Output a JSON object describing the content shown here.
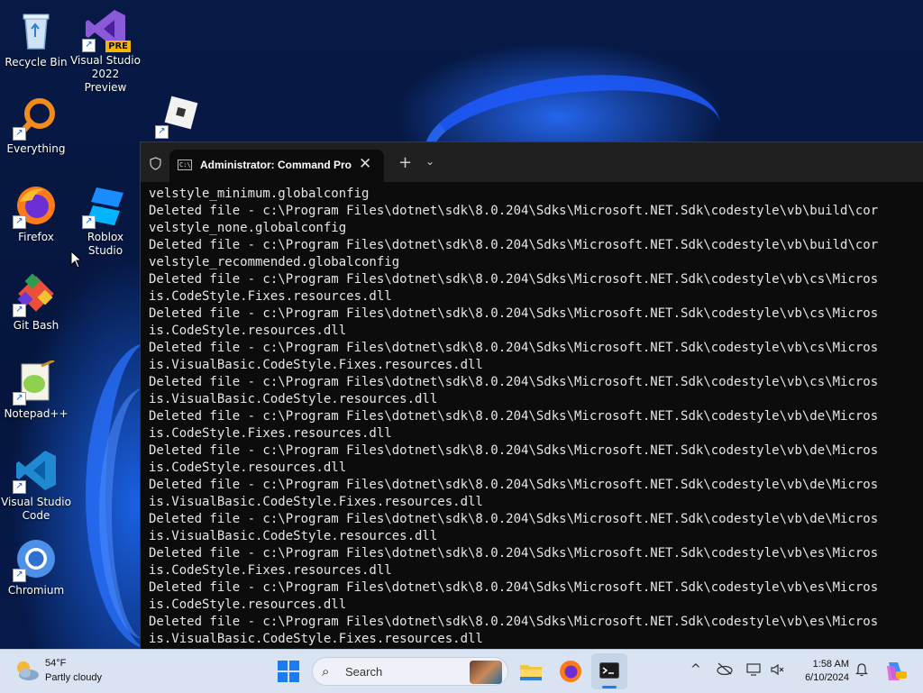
{
  "desktop": {
    "icons": [
      {
        "label": "Recycle Bin"
      },
      {
        "label": "Visual Studio 2022 Preview",
        "badge": "PRE"
      },
      {
        "label": "Everything"
      },
      {
        "label": "Firefox"
      },
      {
        "label": "Roblox Studio"
      },
      {
        "label": "Git Bash"
      },
      {
        "label": "Notepad++"
      },
      {
        "label": "Visual Studio Code"
      },
      {
        "label": "Chromium"
      }
    ]
  },
  "terminal": {
    "tab_title": "Administrator: Command Pro",
    "tab_close": "✕",
    "new_tab": "+",
    "dropdown": "⌄",
    "lines": [
      "velstyle_minimum.globalconfig",
      "Deleted file - c:\\Program Files\\dotnet\\sdk\\8.0.204\\Sdks\\Microsoft.NET.Sdk\\codestyle\\vb\\build\\cor",
      "velstyle_none.globalconfig",
      "Deleted file - c:\\Program Files\\dotnet\\sdk\\8.0.204\\Sdks\\Microsoft.NET.Sdk\\codestyle\\vb\\build\\cor",
      "velstyle_recommended.globalconfig",
      "Deleted file - c:\\Program Files\\dotnet\\sdk\\8.0.204\\Sdks\\Microsoft.NET.Sdk\\codestyle\\vb\\cs\\Micros",
      "is.CodeStyle.Fixes.resources.dll",
      "Deleted file - c:\\Program Files\\dotnet\\sdk\\8.0.204\\Sdks\\Microsoft.NET.Sdk\\codestyle\\vb\\cs\\Micros",
      "is.CodeStyle.resources.dll",
      "Deleted file - c:\\Program Files\\dotnet\\sdk\\8.0.204\\Sdks\\Microsoft.NET.Sdk\\codestyle\\vb\\cs\\Micros",
      "is.VisualBasic.CodeStyle.Fixes.resources.dll",
      "Deleted file - c:\\Program Files\\dotnet\\sdk\\8.0.204\\Sdks\\Microsoft.NET.Sdk\\codestyle\\vb\\cs\\Micros",
      "is.VisualBasic.CodeStyle.resources.dll",
      "Deleted file - c:\\Program Files\\dotnet\\sdk\\8.0.204\\Sdks\\Microsoft.NET.Sdk\\codestyle\\vb\\de\\Micros",
      "is.CodeStyle.Fixes.resources.dll",
      "Deleted file - c:\\Program Files\\dotnet\\sdk\\8.0.204\\Sdks\\Microsoft.NET.Sdk\\codestyle\\vb\\de\\Micros",
      "is.CodeStyle.resources.dll",
      "Deleted file - c:\\Program Files\\dotnet\\sdk\\8.0.204\\Sdks\\Microsoft.NET.Sdk\\codestyle\\vb\\de\\Micros",
      "is.VisualBasic.CodeStyle.Fixes.resources.dll",
      "Deleted file - c:\\Program Files\\dotnet\\sdk\\8.0.204\\Sdks\\Microsoft.NET.Sdk\\codestyle\\vb\\de\\Micros",
      "is.VisualBasic.CodeStyle.resources.dll",
      "Deleted file - c:\\Program Files\\dotnet\\sdk\\8.0.204\\Sdks\\Microsoft.NET.Sdk\\codestyle\\vb\\es\\Micros",
      "is.CodeStyle.Fixes.resources.dll",
      "Deleted file - c:\\Program Files\\dotnet\\sdk\\8.0.204\\Sdks\\Microsoft.NET.Sdk\\codestyle\\vb\\es\\Micros",
      "is.CodeStyle.resources.dll",
      "Deleted file - c:\\Program Files\\dotnet\\sdk\\8.0.204\\Sdks\\Microsoft.NET.Sdk\\codestyle\\vb\\es\\Micros",
      "is.VisualBasic.CodeStyle.Fixes.resources.dll"
    ]
  },
  "taskbar": {
    "weather": {
      "temp": "54°F",
      "desc": "Partly cloudy"
    },
    "search_placeholder": "Search",
    "clock": {
      "time": "1:58 AM",
      "date": "6/10/2024"
    }
  },
  "colors": {
    "accent": "#1a7cf0",
    "terminal_bg": "#0c0c0c",
    "taskbar_bg": "#d9e3f1"
  }
}
